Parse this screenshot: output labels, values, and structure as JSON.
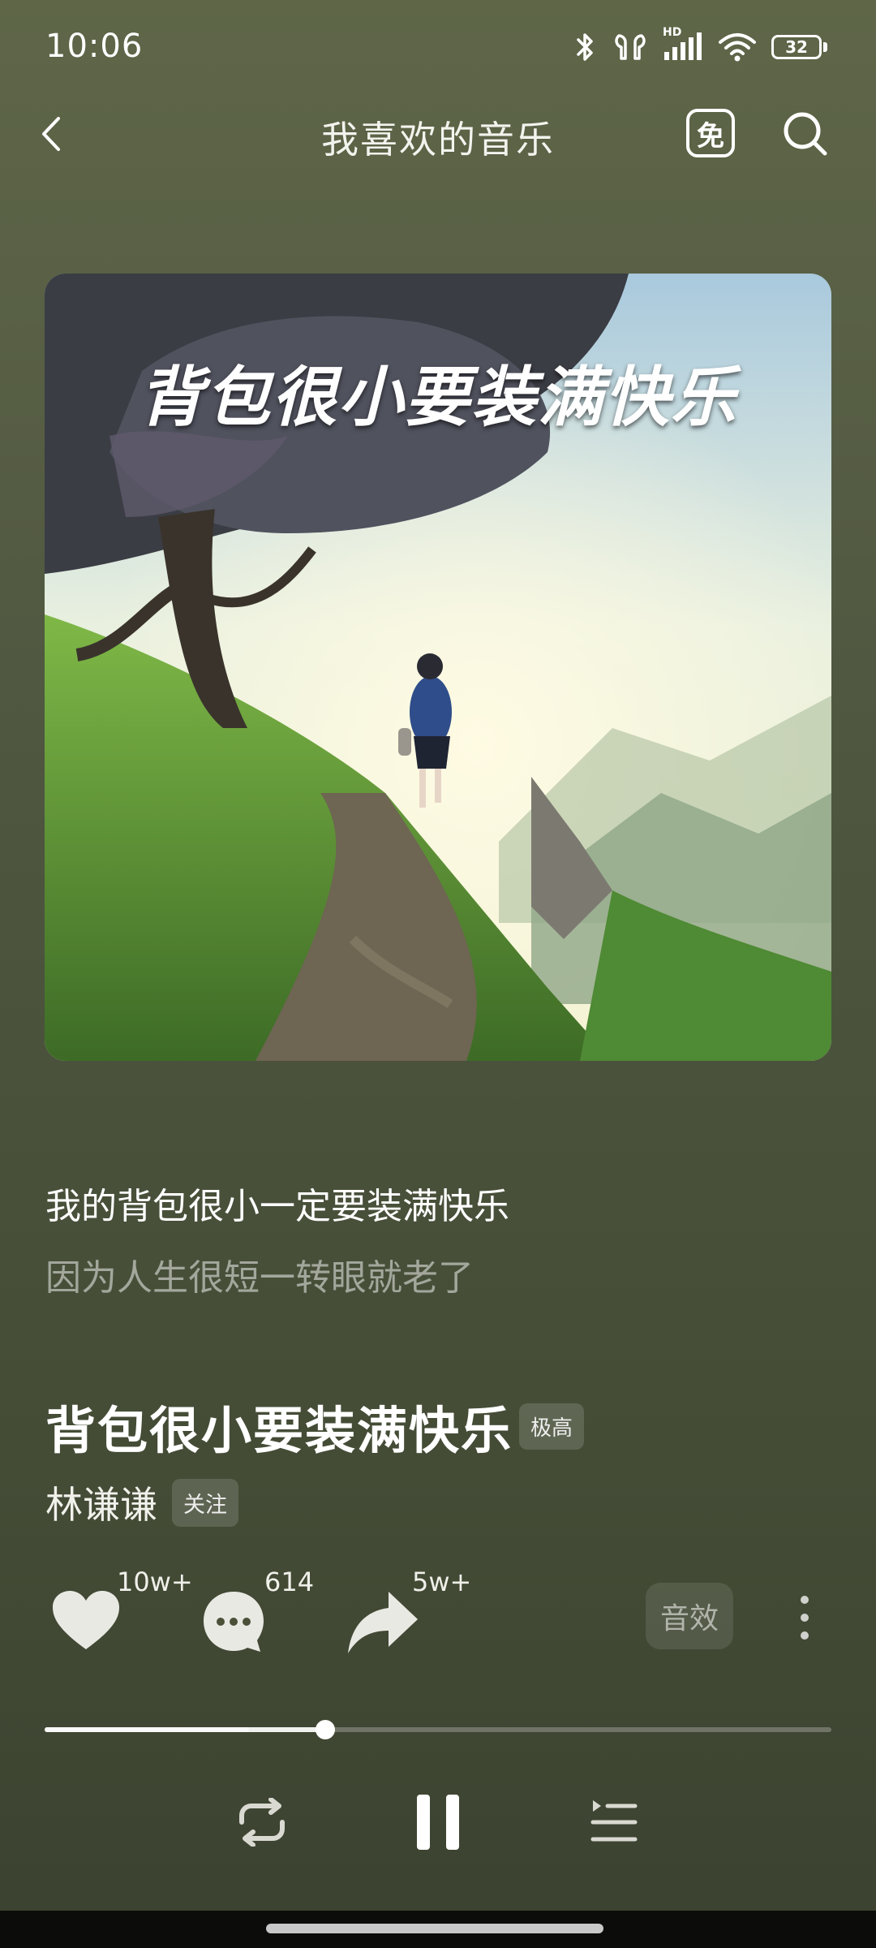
{
  "status_bar": {
    "time": "10:06",
    "network_label": "HD",
    "battery": "32",
    "icons": [
      "bluetooth-icon",
      "earbuds-icon",
      "signal-icon",
      "wifi-icon",
      "battery-icon"
    ]
  },
  "header": {
    "title": "我喜欢的音乐",
    "free_badge": "免",
    "icons": [
      "back-arrow-icon",
      "free-mode-icon",
      "search-icon"
    ]
  },
  "album": {
    "art_title": "背包很小要装满快乐"
  },
  "lyrics": {
    "current": "我的背包很小一定要装满快乐",
    "next": "因为人生很短一转眼就老了"
  },
  "song": {
    "title": "背包很小要装满快乐",
    "quality": "极高",
    "artist": "林谦谦",
    "follow_label": "关注"
  },
  "actions": {
    "like_count": "10w+",
    "comment_count": "614",
    "share_count": "5w+",
    "effect_label": "音效",
    "icons": [
      "heart-icon",
      "comment-icon",
      "share-icon",
      "more-vertical-icon"
    ]
  },
  "progress": {
    "played_fraction": 0.357,
    "buffered_fraction": 0.26
  },
  "controls": {
    "icons": [
      "repeat-icon",
      "pause-icon",
      "playlist-icon"
    ]
  },
  "colors": {
    "background_top": "#5f6648",
    "background_bottom": "#3b4230",
    "accent": "#ffffff"
  }
}
